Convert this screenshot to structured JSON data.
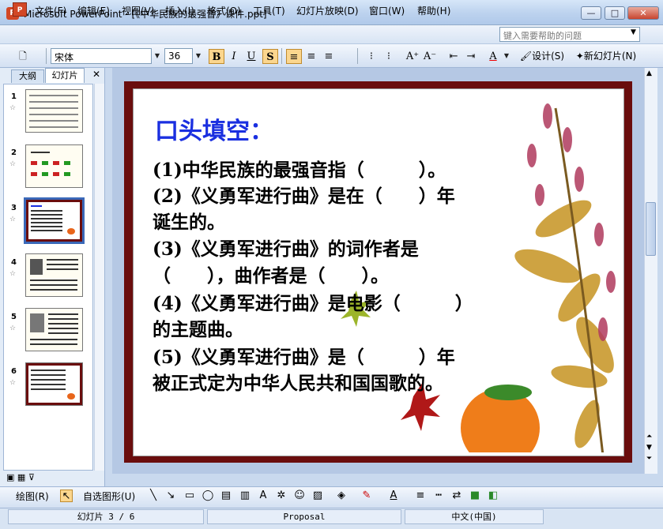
{
  "window": {
    "title": "Microsoft PowerPoint - [《中华民族的最强音》课件.ppt]",
    "app_icon": "P"
  },
  "window_controls": {
    "minimize": "—",
    "maximize": "□",
    "close": "✕"
  },
  "menu": {
    "items": [
      "文件(F)",
      "编辑(E)",
      "视图(V)",
      "插入(I)",
      "格式(O)",
      "工具(T)",
      "幻灯片放映(D)",
      "窗口(W)",
      "帮助(H)"
    ],
    "help_placeholder": "键入需要帮助的问题"
  },
  "toolbar": {
    "font": "宋体",
    "size": "36",
    "bold": "B",
    "italic": "I",
    "underline": "U",
    "shadow": "S",
    "design": "设计(S)",
    "new_slide": "新幻灯片(N)"
  },
  "left_pane": {
    "tab_outline": "大纲",
    "tab_slides": "幻灯片",
    "close": "✕",
    "slide_numbers": [
      "1",
      "2",
      "3",
      "4",
      "5",
      "6"
    ],
    "selected": 3
  },
  "slide": {
    "title": "口头填空：",
    "lines": [
      "(1)中华民族的最强音指（　　　）。",
      "(2)《义勇军进行曲》是在（　　）年",
      "诞生的。",
      "(3)《义勇军进行曲》的词作者是",
      "（　　），曲作者是（　　）。",
      "(4)《义勇军进行曲》是电影（　　　）",
      "的主题曲。",
      "(5)《义勇军进行曲》是（　　　）年",
      "被正式定为中华人民共和国国歌的。"
    ]
  },
  "drawing_toolbar": {
    "draw": "绘图(R)",
    "autoshapes": "自选图形(U)"
  },
  "status": {
    "slide": "幻灯片 3 / 6",
    "design": "Proposal",
    "language": "中文(中国)"
  },
  "colors": {
    "title_blue": "#1a2fe0",
    "frame": "#6a0d0d",
    "selected": "#3a68b8"
  }
}
